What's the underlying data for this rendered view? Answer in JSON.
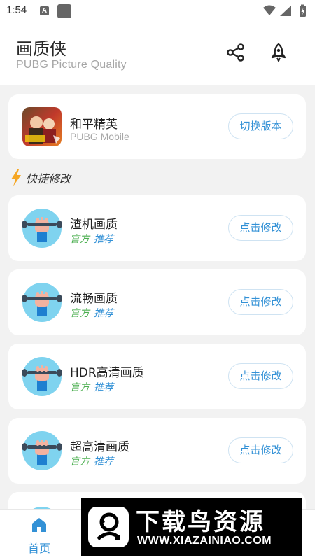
{
  "status_bar": {
    "time": "1:54",
    "notif_letter": "A"
  },
  "header": {
    "title": "画质侠",
    "subtitle": "PUBG Picture Quality",
    "share_icon": "share-icon",
    "rocket_icon": "rocket-icon"
  },
  "version_card": {
    "name": "和平精英",
    "subtitle": "PUBG Mobile",
    "button_label": "切换版本"
  },
  "section": {
    "title": "快捷修改",
    "icon": "lightning-icon"
  },
  "quality_items": [
    {
      "name": "渣机画质",
      "tag_official": "官方",
      "tag_recommend": "推荐",
      "button_label": "点击修改"
    },
    {
      "name": "流畅画质",
      "tag_official": "官方",
      "tag_recommend": "推荐",
      "button_label": "点击修改"
    },
    {
      "name": "HDR高清画质",
      "tag_official": "官方",
      "tag_recommend": "推荐",
      "button_label": "点击修改"
    },
    {
      "name": "超高清画质",
      "tag_official": "官方",
      "tag_recommend": "推荐",
      "button_label": "点击修改"
    }
  ],
  "bottom_nav": {
    "home_label": "首页"
  },
  "watermark": {
    "title": "下载鸟资源",
    "url": "WWW.XIAZAINIAO.COM"
  },
  "colors": {
    "accent": "#3391d6",
    "official_tag": "#4caf50",
    "lightning": "#f5a623",
    "icon_circle": "#7fd3ef"
  }
}
